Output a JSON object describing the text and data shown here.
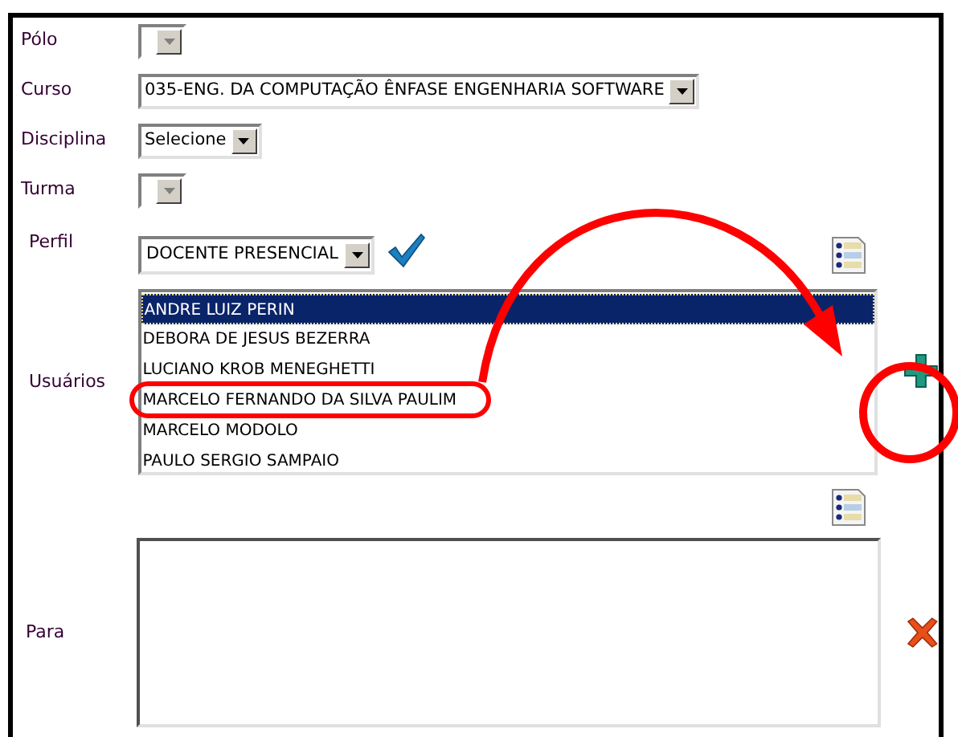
{
  "fields": [
    {
      "label": "Pólo",
      "kind": "small-select"
    },
    {
      "label": "Curso",
      "kind": "select",
      "value": "035-ENG. DA COMPUTAÇÃO ÊNFASE ENGENHARIA SOFTWARE"
    },
    {
      "label": "Disciplina",
      "kind": "select",
      "value": "Selecione"
    },
    {
      "label": "Turma",
      "kind": "small-select"
    }
  ],
  "perfil": {
    "label": "Perfil",
    "value": "DOCENTE PRESENCIAL"
  },
  "usuarios": {
    "label": "Usuários",
    "items": [
      {
        "name": "ANDRE LUIZ PERIN",
        "selected": true
      },
      {
        "name": "DEBORA DE JESUS BEZERRA",
        "selected": false
      },
      {
        "name": "LUCIANO KROB MENEGHETTI",
        "selected": false
      },
      {
        "name": "MARCELO FERNANDO DA SILVA PAULIM",
        "selected": false
      },
      {
        "name": "MARCELO MODOLO",
        "selected": false
      },
      {
        "name": "PAULO SERGIO SAMPAIO",
        "selected": false
      }
    ]
  },
  "para": {
    "label": "Para"
  }
}
